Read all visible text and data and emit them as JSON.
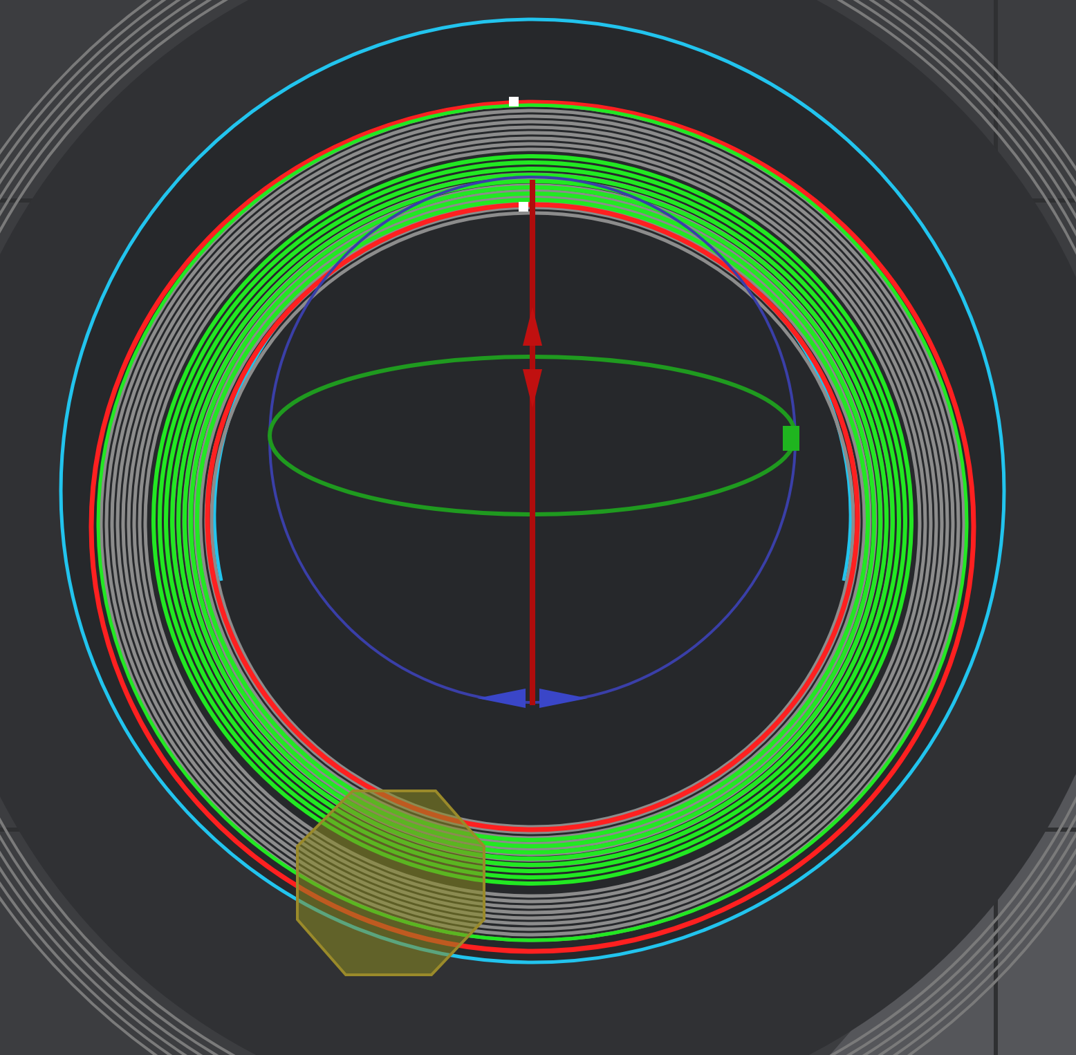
{
  "viewport": {
    "toolpaths": [
      {
        "kind": "travel-boundary",
        "color": "#22c4ee"
      },
      {
        "kind": "previous-layer",
        "color": "#8c8c8c"
      },
      {
        "kind": "outer-wall",
        "color": "#ff2020"
      },
      {
        "kind": "inner-wall",
        "color": "#22e822"
      }
    ]
  }
}
